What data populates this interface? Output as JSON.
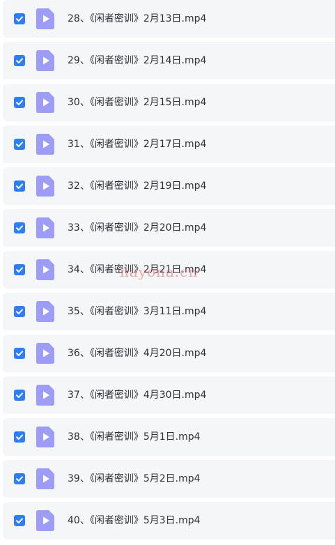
{
  "colors": {
    "checkbox": "#2d7ff9",
    "file_icon": "#9d9cf6",
    "row_background": "#f5f6f8",
    "text": "#2b2f36",
    "watermark": "#ec5f5f"
  },
  "icons": {
    "checkbox": "check-icon",
    "file": "video-file-icon"
  },
  "files": [
    {
      "name": "28、《闲者密训》2月13日.mp4",
      "checked": true
    },
    {
      "name": "29、《闲者密训》2月14日.mp4",
      "checked": true
    },
    {
      "name": "30、《闲者密训》2月15日.mp4",
      "checked": true
    },
    {
      "name": "31、《闲者密训》2月17日.mp4",
      "checked": true
    },
    {
      "name": "32、《闲者密训》2月19日.mp4",
      "checked": true
    },
    {
      "name": "33、《闲者密训》2月20日.mp4",
      "checked": true
    },
    {
      "name": "34、《闲者密训》2月21日.mp4",
      "checked": true
    },
    {
      "name": "35、《闲者密训》3月11日.mp4",
      "checked": true
    },
    {
      "name": "36、《闲者密训》4月20日.mp4",
      "checked": true
    },
    {
      "name": "37、《闲者密训》4月30日.mp4",
      "checked": true
    },
    {
      "name": "38、《闲者密训》5月1日.mp4",
      "checked": true
    },
    {
      "name": "39、《闲者密训》5月2日.mp4",
      "checked": true
    },
    {
      "name": "40、《闲者密训》5月3日.mp4",
      "checked": true
    }
  ],
  "watermark": "nayona.cn"
}
